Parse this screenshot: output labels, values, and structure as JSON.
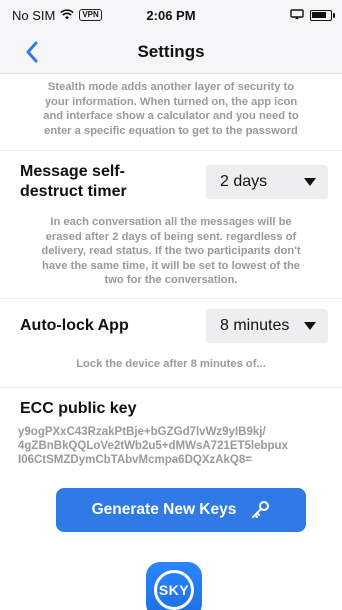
{
  "status_bar": {
    "carrier": "No SIM",
    "vpn": "VPN",
    "time": "2:06 PM"
  },
  "nav": {
    "title": "Settings"
  },
  "stealth": {
    "description_lines": [
      "Stealth mode adds another layer of security to",
      "your information. When turned on, the app icon",
      "and interface show a calculator and you need to",
      "enter a specific equation to get to the password"
    ]
  },
  "self_destruct": {
    "label_line1": "Message self-",
    "label_line2": "destruct timer",
    "selected": "2 days",
    "description_lines": [
      "In each conversation all the messages will be",
      "erased after 2 days of being sent. regardless of",
      "delivery, read status. If the two participants don't",
      "have the same time, it will be set to lowest of the",
      "two for the conversation."
    ]
  },
  "auto_lock": {
    "label": "Auto-lock App",
    "selected": "8 minutes",
    "description": "Lock the device after 8 minutes of..."
  },
  "ecc": {
    "title": "ECC public key",
    "key_lines": [
      "y9ogPXxC43RzakPtBje+bGZGd7lvWz9yIB9kj/",
      "4gZBnBkQQLoVe2tWb2u5+dMWsA721ET5lebpux",
      "I06CtSMZDymCbTAbvMcmpa6DQXzAkQ8="
    ]
  },
  "generate_button": {
    "label": "Generate New Keys",
    "icon": "key-icon"
  },
  "logo": {
    "text": "SKY"
  },
  "colors": {
    "accent": "#2f7ae5",
    "muted_text": "#9a9a9e",
    "dropdown_bg": "#eeeef0"
  }
}
